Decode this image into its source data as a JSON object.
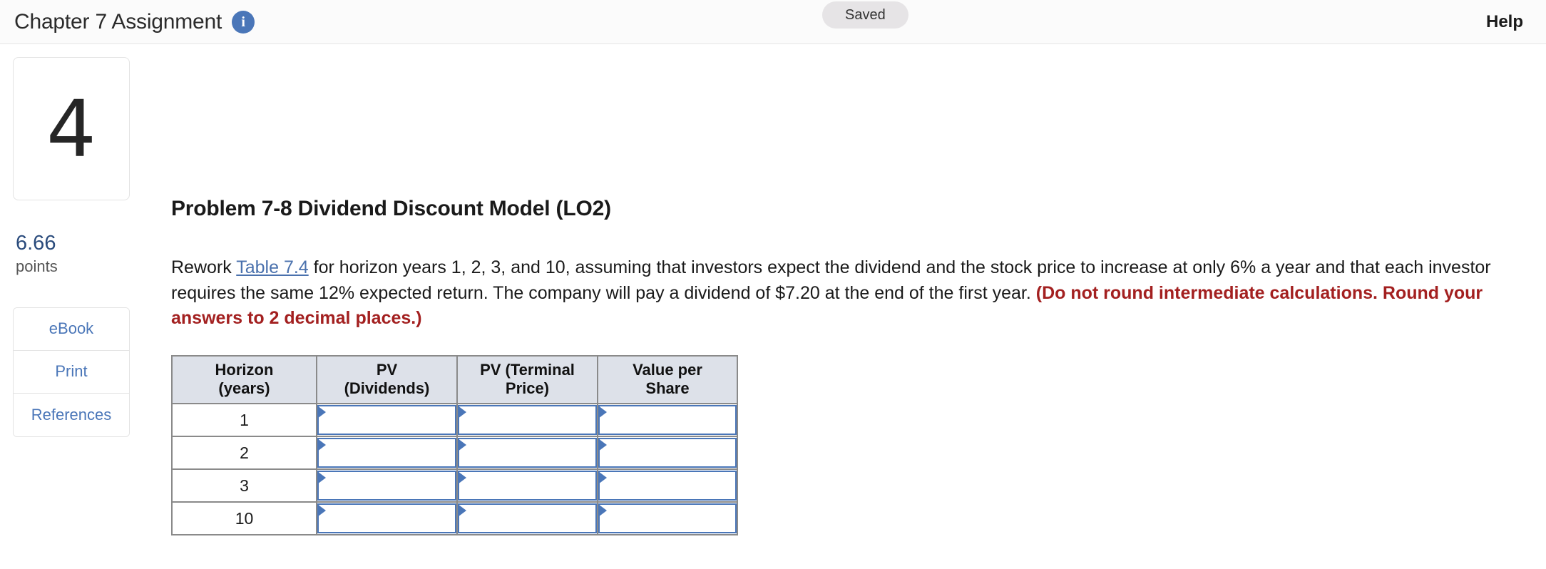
{
  "header": {
    "title": "Chapter 7 Assignment",
    "info_icon": "info-icon",
    "saved_label": "Saved",
    "help_label": "Help"
  },
  "rail": {
    "question_number": "4",
    "points_value": "6.66",
    "points_label": "points",
    "tools": [
      {
        "label": "eBook",
        "name": "ebook"
      },
      {
        "label": "Print",
        "name": "print"
      },
      {
        "label": "References",
        "name": "references"
      }
    ]
  },
  "problem": {
    "title": "Problem 7-8 Dividend Discount Model (LO2)",
    "body": {
      "part1": "Rework ",
      "link": "Table 7.4",
      "part2": " for horizon years 1, 2, 3, and 10, assuming that investors expect the dividend and the stock price to increase at only 6% a year and that each investor requires the same 12% expected return. The company will pay a dividend of $7.20 at the end of the first year. ",
      "emphasis": "(Do not round intermediate calculations. Round your answers to 2 decimal places.)"
    }
  },
  "answer_table": {
    "headers": [
      {
        "line1": "Horizon",
        "line2": "(years)"
      },
      {
        "line1": "PV",
        "line2": "(Dividends)"
      },
      {
        "line1": "PV (Terminal",
        "line2": "Price)"
      },
      {
        "line1": "Value per",
        "line2": "Share"
      }
    ],
    "rows": [
      {
        "year": "1",
        "pv_dividends": "",
        "pv_terminal_price": "",
        "value_per_share": ""
      },
      {
        "year": "2",
        "pv_dividends": "",
        "pv_terminal_price": "",
        "value_per_share": ""
      },
      {
        "year": "3",
        "pv_dividends": "",
        "pv_terminal_price": "",
        "value_per_share": ""
      },
      {
        "year": "10",
        "pv_dividends": "",
        "pv_terminal_price": "",
        "value_per_share": ""
      }
    ]
  },
  "colors": {
    "accent_blue": "#4a76b8",
    "link_blue": "#4a71ad",
    "emphasis_red": "#a32020",
    "points_blue": "#2a4b7c",
    "table_header_bg": "#dde1e9",
    "saved_bg": "#e6e4e6"
  }
}
